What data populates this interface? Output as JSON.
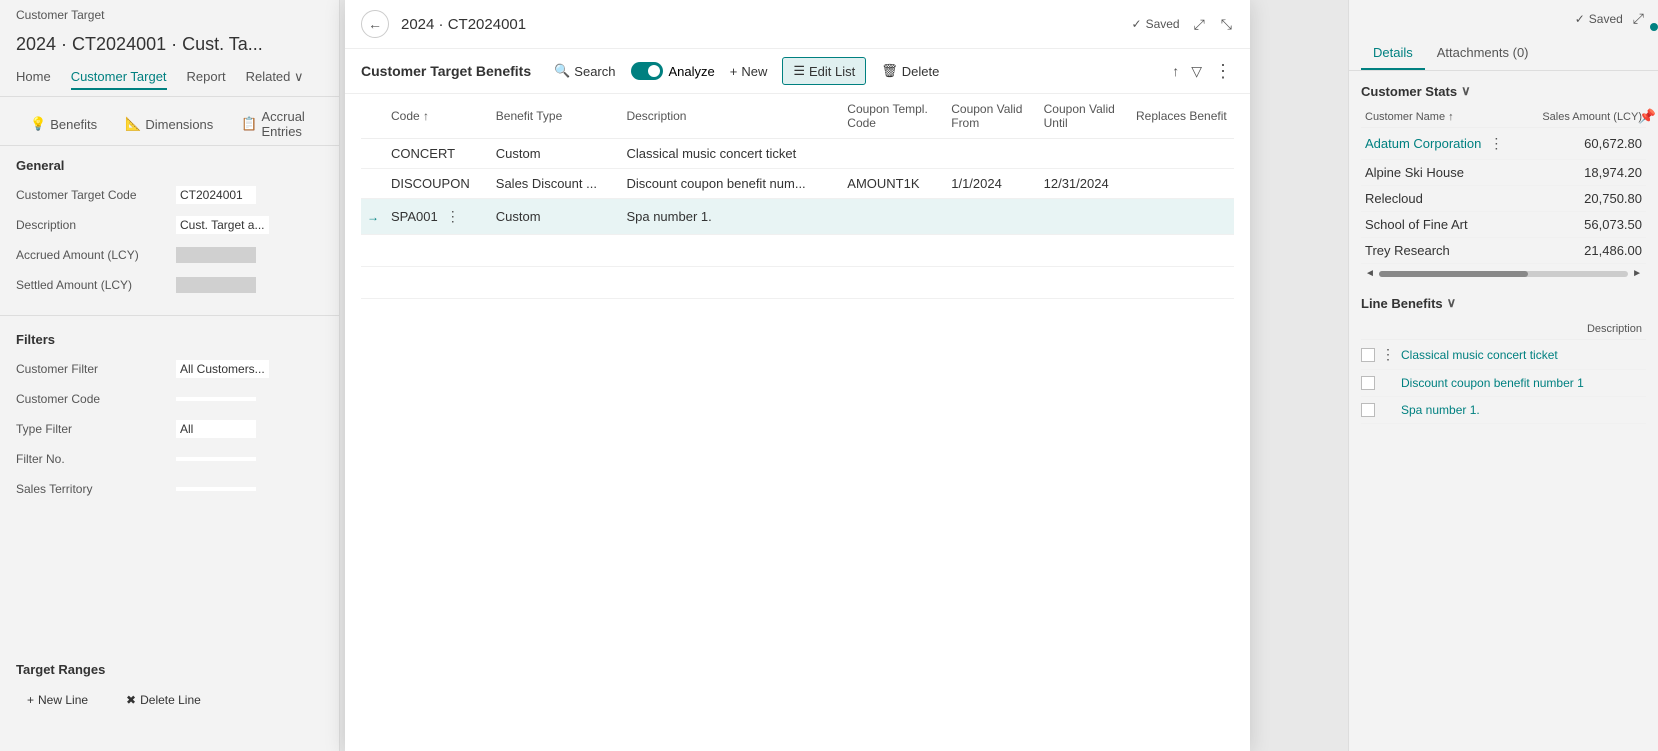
{
  "leftPanel": {
    "breadcrumb": "Customer Target",
    "title": "2024 · CT2024001 · Cust. Ta...",
    "nav": [
      {
        "label": "Home",
        "active": false
      },
      {
        "label": "Customer Target",
        "active": true
      },
      {
        "label": "Report",
        "active": false
      },
      {
        "label": "Related",
        "active": false,
        "dropdown": true
      }
    ],
    "tabs": [
      {
        "label": "Benefits",
        "icon": "💡"
      },
      {
        "label": "Dimensions",
        "icon": "📐"
      },
      {
        "label": "Accrual Entries",
        "icon": "📋"
      }
    ],
    "sections": {
      "general": {
        "title": "General",
        "fields": [
          {
            "label": "Customer Target Code",
            "value": "CT2024001",
            "isGray": false
          },
          {
            "label": "Description",
            "value": "Cust. Target a...",
            "isGray": false
          },
          {
            "label": "Accrued Amount (LCY)",
            "value": "",
            "isGray": true
          },
          {
            "label": "Settled Amount (LCY)",
            "value": "",
            "isGray": true
          }
        ]
      },
      "filters": {
        "title": "Filters",
        "fields": [
          {
            "label": "Customer Filter",
            "value": "All Customers...",
            "isGray": false
          },
          {
            "label": "Customer Code",
            "value": "",
            "isGray": false
          },
          {
            "label": "Type Filter",
            "value": "All",
            "isGray": false
          },
          {
            "label": "Filter No.",
            "value": "",
            "isGray": false
          },
          {
            "label": "Sales Territory",
            "value": "",
            "isGray": false
          }
        ]
      },
      "targetRanges": {
        "title": "Target Ranges",
        "newLine": "New Line",
        "deleteLine": "Delete Line"
      }
    }
  },
  "modal": {
    "title": "2024 · CT2024001",
    "savedStatus": "Saved",
    "toolbar": {
      "title": "Customer Target Benefits",
      "searchLabel": "Search",
      "analyzeLabel": "Analyze",
      "newLabel": "New",
      "editListLabel": "Edit List",
      "deleteLabel": "Delete"
    },
    "table": {
      "columns": [
        {
          "label": "Code",
          "sortable": true
        },
        {
          "label": "Benefit Type"
        },
        {
          "label": "Description"
        },
        {
          "label": "Coupon Templ. Code"
        },
        {
          "label": "Coupon Valid From"
        },
        {
          "label": "Coupon Valid Until"
        },
        {
          "label": "Replaces Benefit"
        }
      ],
      "rows": [
        {
          "arrow": false,
          "code": "CONCERT",
          "benefitType": "Custom",
          "description": "Classical music concert ticket",
          "couponTemplCode": "",
          "couponValidFrom": "",
          "couponValidUntil": "",
          "replacesBenefit": "",
          "selected": false,
          "hasMenu": false
        },
        {
          "arrow": false,
          "code": "DISCOUPON",
          "benefitType": "Sales Discount ...",
          "description": "Discount coupon benefit num...",
          "couponTemplCode": "AMOUNT1K",
          "couponValidFrom": "1/1/2024",
          "couponValidUntil": "12/31/2024",
          "replacesBenefit": "",
          "selected": false,
          "hasMenu": false
        },
        {
          "arrow": true,
          "code": "SPA001",
          "benefitType": "Custom",
          "description": "Spa number 1.",
          "couponTemplCode": "",
          "couponValidFrom": "",
          "couponValidUntil": "",
          "replacesBenefit": "",
          "selected": true,
          "hasMenu": true
        }
      ]
    }
  },
  "rightPanel": {
    "savedStatus": "Saved",
    "tabs": [
      {
        "label": "Details",
        "active": true
      },
      {
        "label": "Attachments (0)",
        "active": false
      }
    ],
    "customerStats": {
      "title": "Customer Stats",
      "colHeader": "Sales Amount (LCY)",
      "rows": [
        {
          "name": "Adatum Corporation",
          "amount": "60,672.80",
          "isLink": true,
          "hasMenu": true
        },
        {
          "name": "Alpine Ski House",
          "amount": "18,974.20",
          "isLink": false
        },
        {
          "name": "Relecloud",
          "amount": "20,750.80",
          "isLink": false
        },
        {
          "name": "School of Fine Art",
          "amount": "56,073.50",
          "isLink": false
        },
        {
          "name": "Trey Research",
          "amount": "21,486.00",
          "isLink": false
        }
      ]
    },
    "lineBenefits": {
      "title": "Line Benefits",
      "colHeader": "Description",
      "rows": [
        {
          "description": "Classical music concert ticket"
        },
        {
          "description": "Discount coupon benefit number 1"
        },
        {
          "description": "Spa number 1."
        }
      ]
    }
  },
  "icons": {
    "back": "←",
    "expand": "⤢",
    "fullscreen": "⤡",
    "saved_check": "✓",
    "search": "🔍",
    "new": "+",
    "edit_list": "☰",
    "delete": "🗑",
    "share": "↑",
    "filter": "▽",
    "more": "⋮",
    "arrow_right": "→",
    "chevron_down": "∨",
    "scroll_left": "◄",
    "scroll_right": "►",
    "pin": "📌"
  }
}
